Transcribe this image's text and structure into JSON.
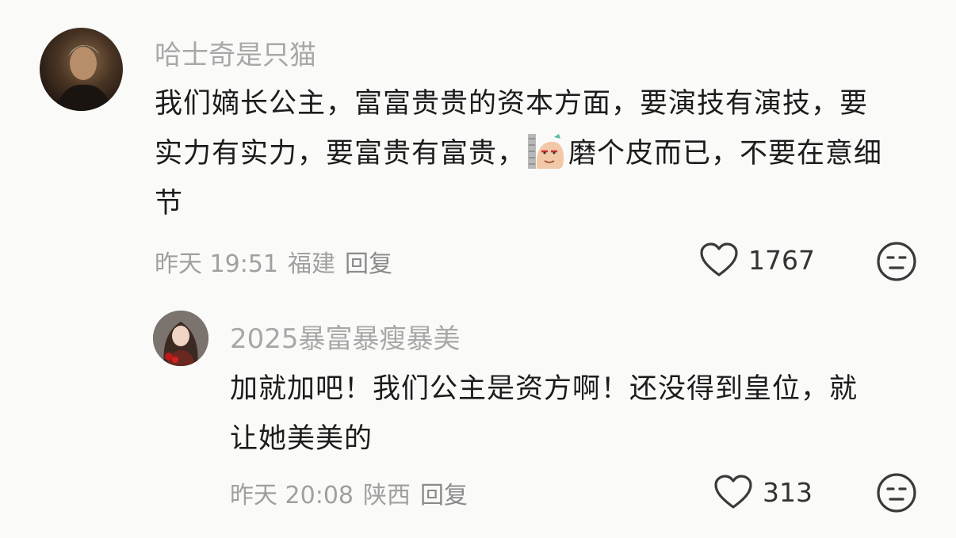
{
  "comments": [
    {
      "username": "哈士奇是只猫",
      "text_before": "我们嫡长公主，富富贵贵的资本方面，要演技有演技，要实力有实力，要富贵有富贵，",
      "emoji": "smirk-sticker-icon",
      "text_after": "磨个皮而已，不要在意细节",
      "time": "昨天 19:51",
      "location": "福建",
      "reply_label": "回复",
      "likes": "1767"
    },
    {
      "username": "2025暴富暴瘦暴美",
      "text": "加就加吧！我们公主是资方啊！还没得到皇位，就让她美美的",
      "time": "昨天 20:08",
      "location": "陕西",
      "reply_label": "回复",
      "likes": "313"
    }
  ],
  "colors": {
    "background": "#fafaf8",
    "username": "#a8a8a8",
    "meta": "#a0a0a0",
    "icon": "#3a3a3a"
  }
}
